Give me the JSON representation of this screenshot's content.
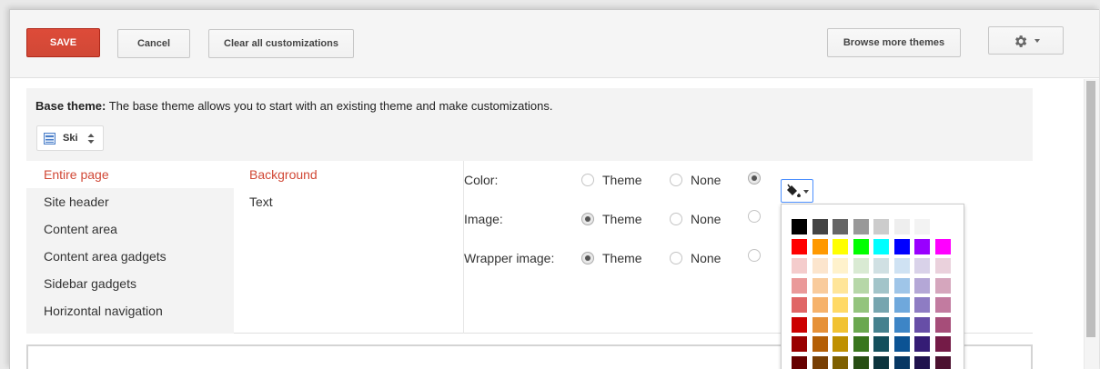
{
  "toolbar": {
    "save_label": "SAVE",
    "cancel_label": "Cancel",
    "clear_label": "Clear all customizations",
    "browse_label": "Browse more themes"
  },
  "base_theme": {
    "heading": "Base theme:",
    "description": " The base theme allows you to start with an existing theme and make customizations.",
    "selected": "Ski"
  },
  "categories": [
    "Entire page",
    "Site header",
    "Content area",
    "Content area gadgets",
    "Sidebar gadgets",
    "Horizontal navigation"
  ],
  "active_category": "Entire page",
  "subcategories": [
    "Background",
    "Text"
  ],
  "active_subcategory": "Background",
  "settings": {
    "color_label": "Color:",
    "image_label": "Image:",
    "wrapper_label": "Wrapper image:",
    "theme_option": "Theme",
    "none_option": "None"
  },
  "palette": [
    [
      "#000000",
      "#444444",
      "#666666",
      "#999999",
      "#cccccc",
      "#eeeeee",
      "#f3f3f3",
      "#ffffff"
    ],
    [
      "#ff0000",
      "#ff9900",
      "#ffff00",
      "#00ff00",
      "#00ffff",
      "#0000ff",
      "#9900ff",
      "#ff00ff"
    ],
    [
      "#f4cccc",
      "#fce5cd",
      "#fff2cc",
      "#d9ead3",
      "#d0e0e3",
      "#cfe2f3",
      "#d9d2e9",
      "#ead1dc"
    ],
    [
      "#ea9999",
      "#f9cb9c",
      "#ffe599",
      "#b6d7a8",
      "#a2c4c9",
      "#9fc5e8",
      "#b4a7d6",
      "#d5a6bd"
    ],
    [
      "#e06666",
      "#f6b26b",
      "#ffd966",
      "#93c47d",
      "#76a5af",
      "#6fa8dc",
      "#8e7cc3",
      "#c27ba0"
    ],
    [
      "#cc0000",
      "#e69138",
      "#f1c232",
      "#6aa84f",
      "#45818e",
      "#3d85c6",
      "#674ea7",
      "#a64d79"
    ],
    [
      "#990000",
      "#b45f06",
      "#bf9000",
      "#38761d",
      "#134f5c",
      "#0b5394",
      "#351c75",
      "#741b47"
    ],
    [
      "#660000",
      "#783f04",
      "#7f6000",
      "#274e13",
      "#0c343d",
      "#073763",
      "#20124d",
      "#4c1130"
    ]
  ],
  "colors": {
    "accent": "#d14836",
    "focus": "#4d90fe"
  }
}
